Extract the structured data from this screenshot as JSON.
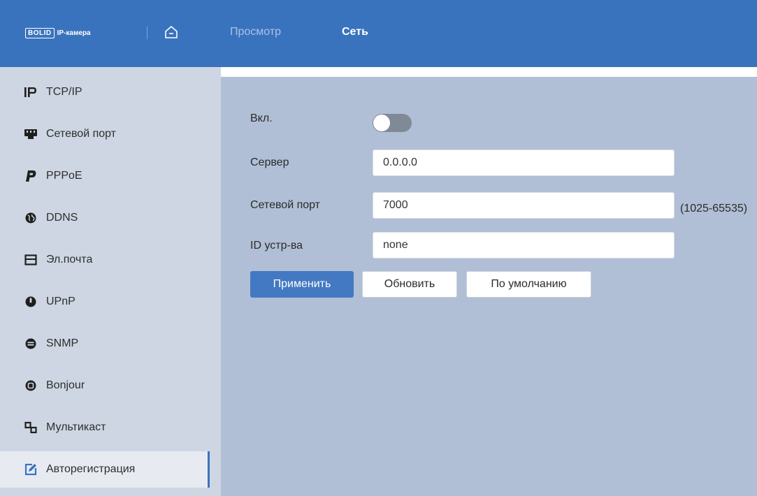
{
  "header": {
    "logo_mark": "BOLID",
    "logo_text": "IP-камера",
    "home_icon": "home-icon",
    "tabs": [
      {
        "label": "Просмотр",
        "active": false
      },
      {
        "label": "Сеть",
        "active": true
      }
    ],
    "color": "#3a73bd"
  },
  "sidebar": {
    "items": [
      {
        "label": "TCP/IP",
        "icon": "ip-icon"
      },
      {
        "label": "Сетевой порт",
        "icon": "network-port-icon"
      },
      {
        "label": "PPPoE",
        "icon": "pppoe-icon"
      },
      {
        "label": "DDNS",
        "icon": "globe-icon"
      },
      {
        "label": "Эл.почта",
        "icon": "mail-icon"
      },
      {
        "label": "UPnP",
        "icon": "upnp-icon"
      },
      {
        "label": "SNMP",
        "icon": "snmp-icon"
      },
      {
        "label": "Bonjour",
        "icon": "bonjour-icon"
      },
      {
        "label": "Мультикаст",
        "icon": "multicast-icon"
      },
      {
        "label": "Авторегистрация",
        "icon": "edit-icon",
        "selected": true
      }
    ]
  },
  "form": {
    "enable_label": "Вкл.",
    "enable_value": false,
    "server_label": "Сервер",
    "server_value": "0.0.0.0",
    "port_label": "Сетевой порт",
    "port_value": "7000",
    "port_hint": "(1025-65535)",
    "device_id_label": "ID устр-ва",
    "device_id_value": "none",
    "apply_label": "Применить",
    "refresh_label": "Обновить",
    "default_label": "По умолчанию"
  }
}
